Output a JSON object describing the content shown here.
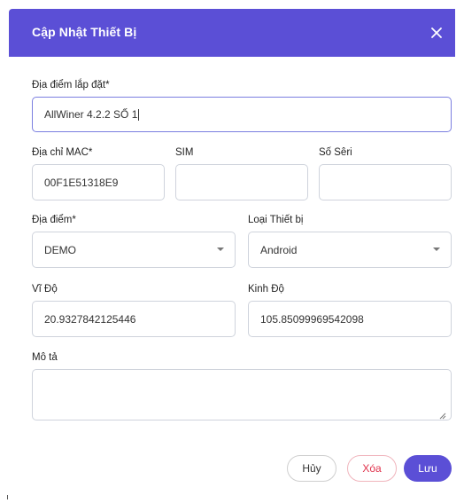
{
  "header": {
    "title": "Cập Nhật Thiết Bị",
    "close_icon": "close-icon"
  },
  "form": {
    "install_location": {
      "label": "Địa điểm lắp đặt*",
      "value": "AllWiner 4.2.2 SỐ 1"
    },
    "mac_address": {
      "label": "Địa chỉ MAC*",
      "value": "00F1E51318E9"
    },
    "sim": {
      "label": "SIM",
      "value": ""
    },
    "serial": {
      "label": "Số Sêri",
      "value": ""
    },
    "location": {
      "label": "Địa điểm*",
      "selected": "DEMO"
    },
    "device_type": {
      "label": "Loại Thiết bị",
      "selected": "Android"
    },
    "latitude": {
      "label": "Vĩ Độ",
      "value": "20.9327842125446"
    },
    "longitude": {
      "label": "Kinh Độ",
      "value": "105.85099969542098"
    },
    "description": {
      "label": "Mô tả",
      "value": ""
    }
  },
  "buttons": {
    "cancel": "Hủy",
    "delete": "Xóa",
    "save": "Lưu"
  },
  "colors": {
    "header_bg": "#5b4fd6",
    "save_bg": "#5b4fd6",
    "delete_text": "#e0314b"
  }
}
